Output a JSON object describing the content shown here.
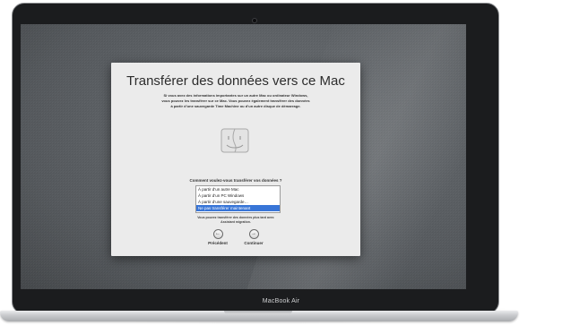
{
  "device": {
    "brand_label": "MacBook Air"
  },
  "dialog": {
    "title": "Transférer des données vers ce Mac",
    "intro_lines": [
      "Si vous avez des informations importantes sur un autre Mac ou ordinateur Windows,",
      "vous pouvez les transférer sur ce Mac. Vous pouvez également transférer des données",
      "à partir d’une sauvegarde Time Machine ou d’un autre disque de démarrage."
    ],
    "question": "Comment voulez-vous transférer vos données ?",
    "options": [
      "À partir d’un autre Mac",
      "À partir d’un PC Windows",
      "À partir d’une sauvegarde…",
      "Ne pas transférer maintenant"
    ],
    "selected_option_index": 3,
    "note_lines": [
      "Vous pouvez transférer des données plus tard avec",
      "Assistant migration."
    ],
    "back_label": "Précédent",
    "continue_label": "Continuer",
    "icons": {
      "app": "finder-icon",
      "back": "back-arrow-icon",
      "continue": "forward-arrow-icon"
    }
  }
}
